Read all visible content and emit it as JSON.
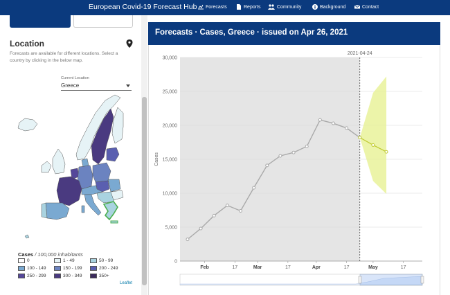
{
  "nav": {
    "brand": "European Covid-19 Forecast Hub",
    "items": [
      {
        "label": "Forecasts",
        "icon": "chart-icon"
      },
      {
        "label": "Reports",
        "icon": "document-icon"
      },
      {
        "label": "Community",
        "icon": "users-icon"
      },
      {
        "label": "Background",
        "icon": "info-icon"
      },
      {
        "label": "Contact",
        "icon": "envelope-icon"
      }
    ]
  },
  "location": {
    "title": "Location",
    "description": "Forecasts are available for different locations. Select a country by clicking in the below map.",
    "current_label": "Current Location",
    "current_value": "Greece"
  },
  "legend": {
    "title_bold": "Cases",
    "title_rest": " / 100,000 inhabitants",
    "items": [
      {
        "label": "0",
        "color": "#ffffff"
      },
      {
        "label": "1 - 49",
        "color": "#e6f3f6"
      },
      {
        "label": "50 - 99",
        "color": "#a9d3e0"
      },
      {
        "label": "100 - 149",
        "color": "#7aa9d1"
      },
      {
        "label": "150 - 199",
        "color": "#6b83c0"
      },
      {
        "label": "200 - 249",
        "color": "#5a5fb0"
      },
      {
        "label": "250 - 299",
        "color": "#55479a"
      },
      {
        "label": "300 - 349",
        "color": "#4a3a80"
      },
      {
        "label": "350+",
        "color": "#3b2a5c"
      }
    ],
    "attribution": "Leaflet"
  },
  "chart_header": "Forecasts · Cases, Greece  · issued on Apr 26, 2021",
  "chart_data": {
    "type": "line",
    "title": "",
    "ylabel": "Cases",
    "xlabel": "",
    "ylim": [
      0,
      30000
    ],
    "yticks": [
      "0",
      "5,000",
      "10,000",
      "15,000",
      "20,000",
      "25,000",
      "30,000"
    ],
    "xticks": [
      "Feb",
      "17",
      "Mar",
      "17",
      "Apr",
      "17",
      "May",
      "17"
    ],
    "issue_marker": "2021-04-24",
    "observed": [
      {
        "x": "2021-01-23",
        "y": 3200
      },
      {
        "x": "2021-01-30",
        "y": 4800
      },
      {
        "x": "2021-02-06",
        "y": 6700
      },
      {
        "x": "2021-02-13",
        "y": 8200
      },
      {
        "x": "2021-02-20",
        "y": 7400
      },
      {
        "x": "2021-02-27",
        "y": 10800
      },
      {
        "x": "2021-03-06",
        "y": 14100
      },
      {
        "x": "2021-03-13",
        "y": 15500
      },
      {
        "x": "2021-03-20",
        "y": 16000
      },
      {
        "x": "2021-03-27",
        "y": 16900
      },
      {
        "x": "2021-04-03",
        "y": 20800
      },
      {
        "x": "2021-04-10",
        "y": 20300
      },
      {
        "x": "2021-04-17",
        "y": 19600
      },
      {
        "x": "2021-04-24",
        "y": 18200
      }
    ],
    "forecast": [
      {
        "x": "2021-04-24",
        "y": 18200,
        "lower": 18200,
        "upper": 18200
      },
      {
        "x": "2021-05-01",
        "y": 17100,
        "lower": 11800,
        "upper": 24800
      },
      {
        "x": "2021-05-08",
        "y": 16100,
        "lower": 9900,
        "upper": 27200
      }
    ],
    "colors": {
      "observed": "#a9a9a9",
      "forecast": "#d4e157",
      "band": "#e9f29a",
      "past_bg": "#e5e5e5"
    }
  }
}
